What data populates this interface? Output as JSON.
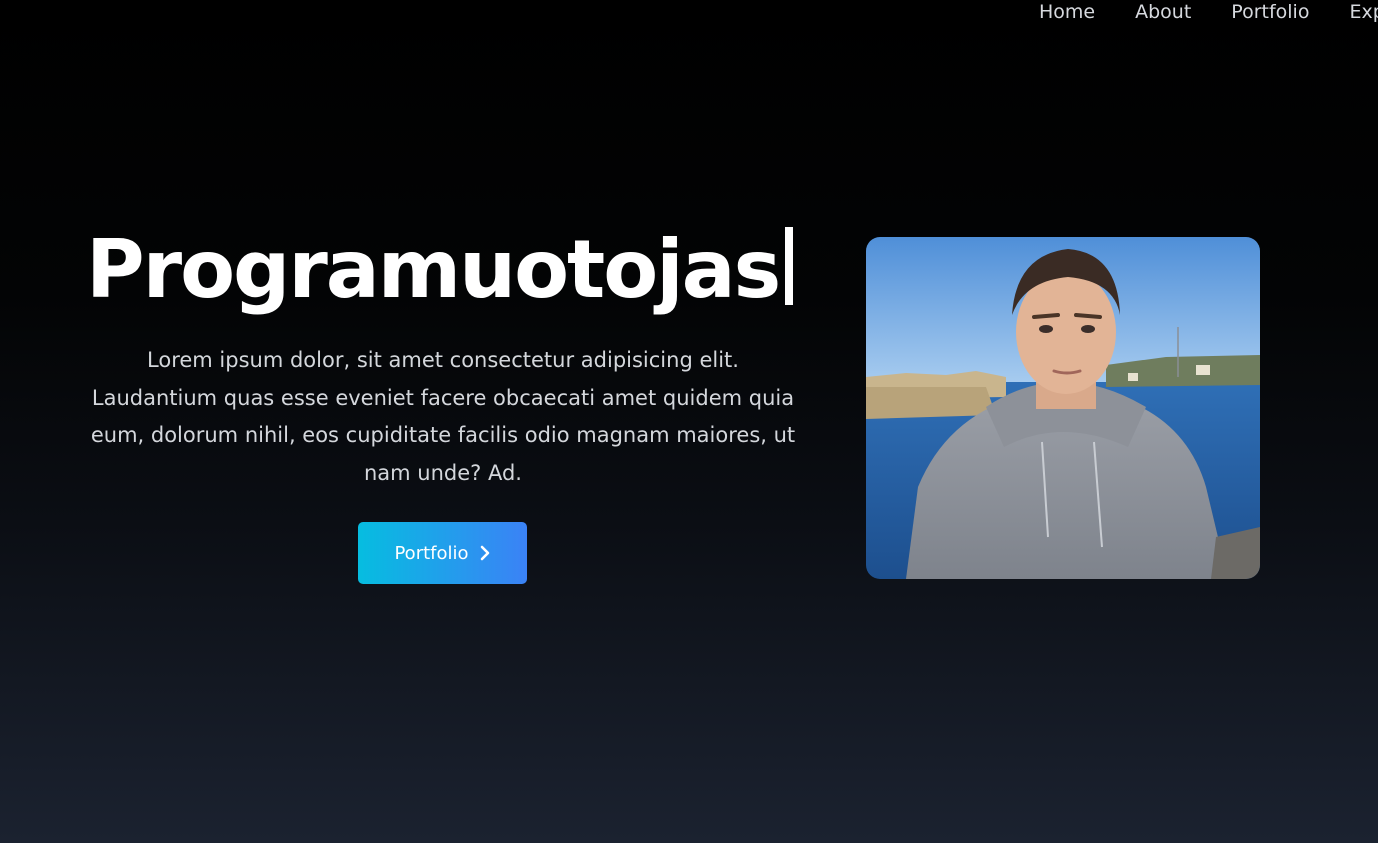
{
  "nav": {
    "items": [
      {
        "label": "Home"
      },
      {
        "label": "About"
      },
      {
        "label": "Portfolio"
      },
      {
        "label": "Exp"
      }
    ]
  },
  "hero": {
    "title": "Programuotojas",
    "description": "Lorem ipsum dolor, sit amet consectetur adipisicing elit. Laudantium quas esse eveniet facere obcaecati amet quidem quia eum, dolorum nihil, eos cupiditate facilis odio magnam maiores, ut nam unde? Ad.",
    "cta": {
      "label": "Portfolio",
      "icon": "chevron-right-icon"
    }
  },
  "profile_photo": {
    "subject": "portrait-photo"
  },
  "colors": {
    "background_top": "#000000",
    "background_bottom": "#1b2230",
    "button_gradient_start": "#06bde0",
    "button_gradient_end": "#3b82f6",
    "text_primary": "#ffffff",
    "text_secondary": "#d4d7dc"
  }
}
